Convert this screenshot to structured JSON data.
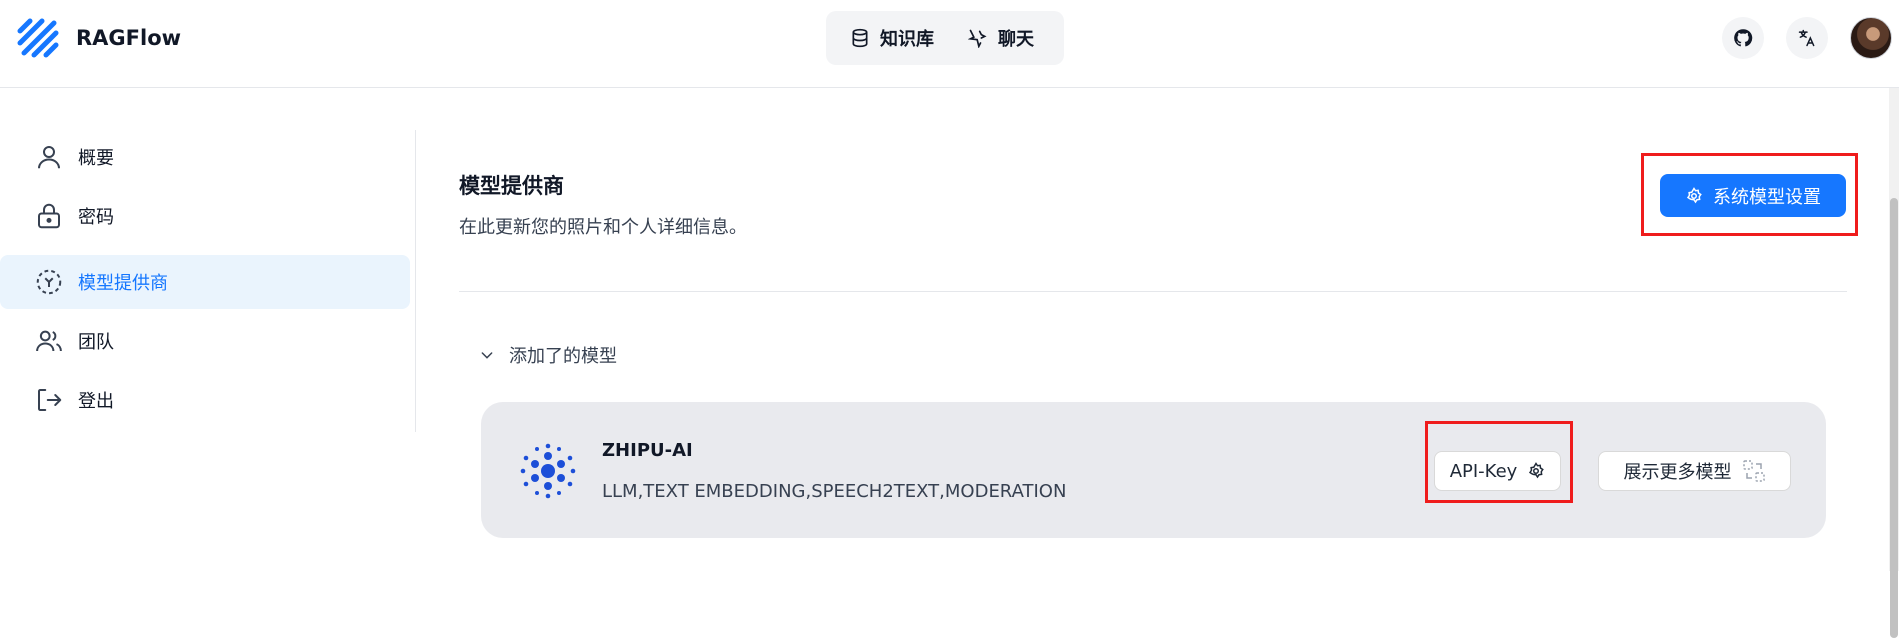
{
  "header": {
    "app_title": "RAGFlow",
    "nav": [
      {
        "label": "知识库",
        "icon": "database-icon"
      },
      {
        "label": "聊天",
        "icon": "chat-sparkle-icon"
      }
    ],
    "github_icon": "github-icon",
    "translate_icon": "translate-icon"
  },
  "sidebar": {
    "items": [
      {
        "label": "概要",
        "icon": "user-icon",
        "active": false
      },
      {
        "label": "密码",
        "icon": "lock-icon",
        "active": false
      },
      {
        "label": "模型提供商",
        "icon": "model-provider-icon",
        "active": true
      },
      {
        "label": "团队",
        "icon": "team-icon",
        "active": false
      },
      {
        "label": "登出",
        "icon": "logout-icon",
        "active": false
      }
    ]
  },
  "main": {
    "title": "模型提供商",
    "description": "在此更新您的照片和个人详细信息。",
    "system_settings_label": "系统模型设置",
    "added_models_label": "添加了的模型",
    "models": [
      {
        "name": "ZHIPU-AI",
        "tags": "LLM,TEXT EMBEDDING,SPEECH2TEXT,MODERATION",
        "api_key_label": "API-Key",
        "show_more_label": "展示更多模型"
      }
    ]
  },
  "colors": {
    "accent": "#1677ff",
    "highlight_border": "#ef1c1c",
    "active_bg": "#eaf4fd"
  }
}
